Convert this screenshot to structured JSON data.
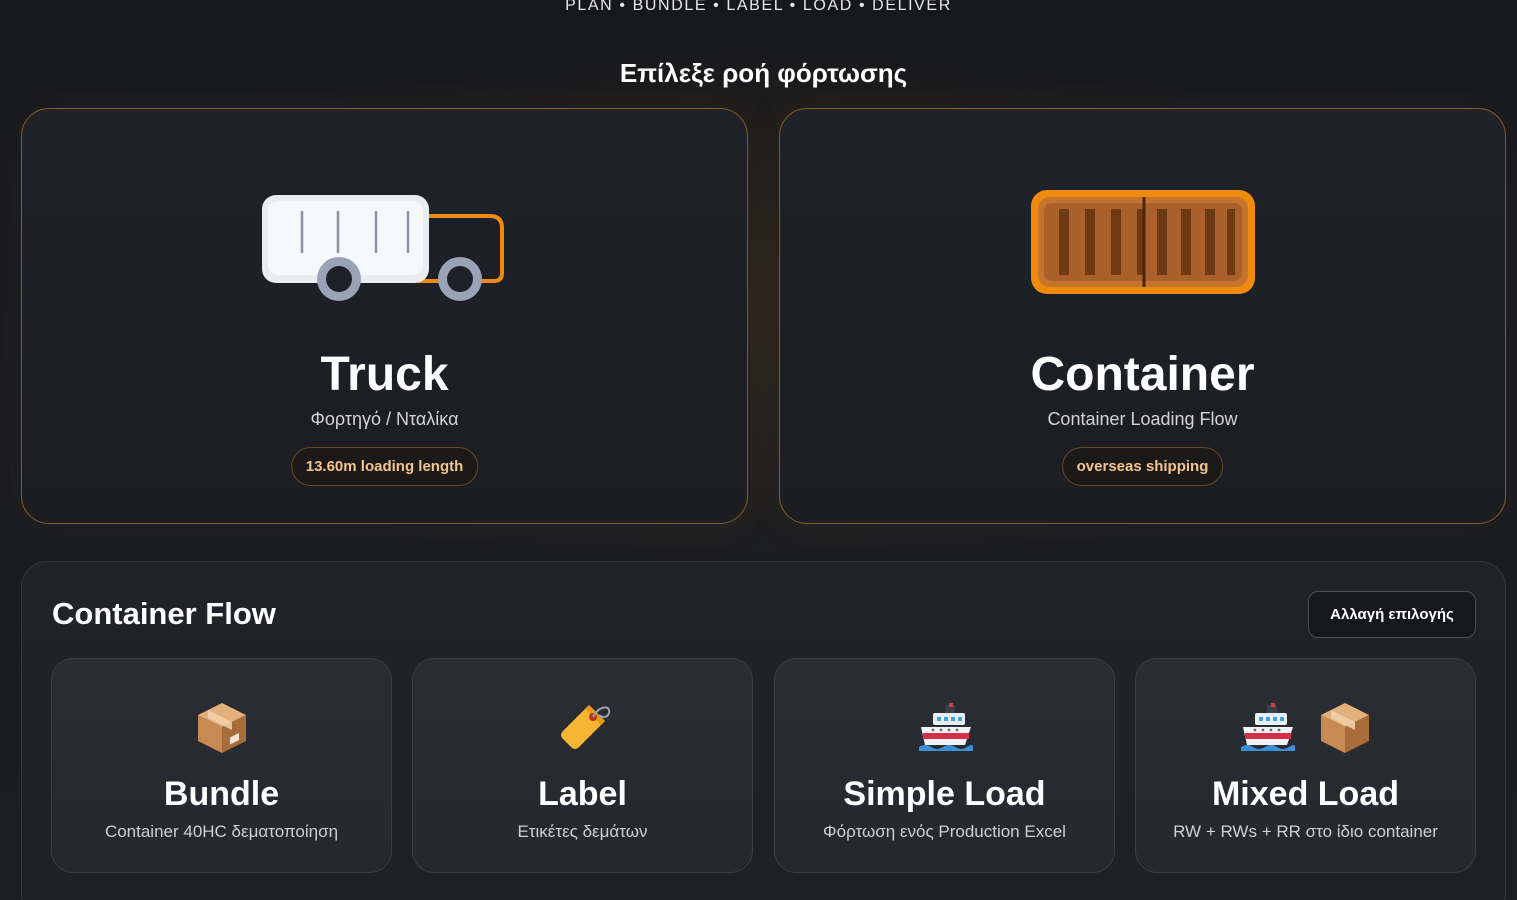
{
  "header": {
    "tagline": "PLAN • BUNDLE • LABEL • LOAD • DELIVER",
    "choose_title": "Επίλεξε ροή φόρτωσης"
  },
  "modes": [
    {
      "title": "Truck",
      "subtitle": "Φορτηγό / Νταλίκα",
      "pill": "13.60m loading length",
      "icon": "truck-icon"
    },
    {
      "title": "Container",
      "subtitle": "Container Loading Flow",
      "pill": "overseas shipping",
      "icon": "shipping-container-icon"
    }
  ],
  "flow": {
    "title": "Container Flow",
    "change_button": "Αλλαγή επιλογής",
    "steps": [
      {
        "title": "Bundle",
        "subtitle": "Container 40HC δεματοποίηση",
        "icons": [
          "package-icon"
        ]
      },
      {
        "title": "Label",
        "subtitle": "Ετικέτες δεμάτων",
        "icons": [
          "label-tag-icon"
        ]
      },
      {
        "title": "Simple Load",
        "subtitle": "Φόρτωση ενός Production Excel",
        "icons": [
          "ship-icon"
        ]
      },
      {
        "title": "Mixed Load",
        "subtitle": "RW + RWs + RR στο ίδιο container",
        "icons": [
          "ship-icon",
          "package-icon"
        ]
      }
    ]
  },
  "colors": {
    "accent": "#f08a0c",
    "accent_border": "#8a5a1c",
    "pill_text": "#f3c58c",
    "background": "#16181d"
  }
}
